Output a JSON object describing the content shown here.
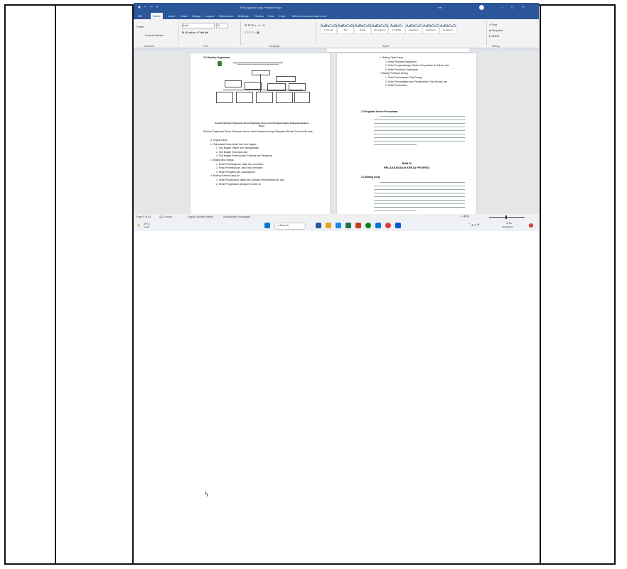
{
  "word": {
    "title": "Pdf Laporan Kerja Praktek Fauzi",
    "tabs": [
      "File",
      "Home",
      "Insert",
      "Draw",
      "Design",
      "Layout",
      "References",
      "Mailings",
      "Review",
      "View",
      "Help",
      "Tell me what you want to do"
    ],
    "active_tab": "Home",
    "ribbon": {
      "paste": "Paste",
      "format_painter": "Format Painter",
      "font_name": "Arial",
      "font_size": "11",
      "styles": [
        "AaBbCcDd",
        "AaBbCcDd",
        "AaBbCcDd",
        "AaBbCcDd",
        "AaBbCc",
        "AaBbCcD",
        "AaBbCcD",
        "AaBbCcD"
      ],
      "style_names": [
        "1 Normal",
        "Title",
        "Quote",
        "No Spacing",
        "1 Subtitle",
        "Heading 1",
        "Heading 2",
        "Heading 3"
      ],
      "find": "Find",
      "replace": "Replace",
      "select": "Select",
      "groups": [
        "Clipboard",
        "Font",
        "Paragraph",
        "Styles",
        "Editing"
      ]
    },
    "left_page": {
      "heading": "2.2    Struktur Organisasi",
      "caption": "Gambar Struktur Organisasi Dinas Pekerjaan Umum dan Penataan Ruang Kabupaten Bekasi Timur",
      "body_intro": "Struktur Organisasi Dinas Pekerjaan Umum dan Penataan Ruang Kabupaten Bekasi Timur terdiri atas:",
      "items": [
        "a. Kepala Dinas",
        "b. Sekretariat Dinas terdiri dari Sub Bagian:",
        "1. Sub Bagian Umum dan Kepegawaian",
        "2. Sub Bagian Keuangan dan",
        "3. Sub Bagian Perencanaan Evaluasi dan Pelaporan",
        "c. Bidang Bina Marga",
        "1. Seksi Pembangunan Jalan dan Jembatan",
        "2. Seksi Pemeliharaan Jalan dan Jembatan",
        "3. Seksi Peralatan dan Laboratorium",
        "d. Bidang Sumber Daya Air",
        "1. Seksi Pengelolaan Irigasi dan Jaringan Pemanfaatan air, dan",
        "2. Seksi Pengelolaan Jaringan Sumber air"
      ]
    },
    "right_page": {
      "items": [
        "e. Bidang Cipta Karya",
        "1. Seksi Penataan Bangunan",
        "2. Seksi Pengembangan Sistem Penyediaan Air Minum dan",
        "3. Seksi Penataan Lingkungan",
        "f. Bidang Penataan Ruang",
        "1. Seksi Perencanaan Tata Ruang",
        "2. Seksi Pemanfaatan dan Pengendalian Tata Ruang, dan",
        "3. Seksi Pertanahan"
      ],
      "section_23": "2.3    Kegiatan Umum Perusahaan",
      "bab_title": "BAB III",
      "bab_subtitle": "PELAKSANAAN KERJA PROFESI",
      "section_31": "3.1    Bidang Kerja"
    },
    "status": {
      "page": "Page 9 of 63",
      "words": "4127 words",
      "language": "English (United States)",
      "accessibility": "Accessibility: Investigate"
    }
  },
  "taskbar": {
    "weather_temp": "29°C",
    "weather_desc": "Cerah",
    "search_placeholder": "Search",
    "time": "9:14",
    "date": "10/03/2023",
    "icon_colors": [
      "#2b579a",
      "#e8a317",
      "#1e88e5",
      "#217346",
      "#c43e1c",
      "#107c10",
      "#0078d4",
      "#e53935"
    ]
  }
}
